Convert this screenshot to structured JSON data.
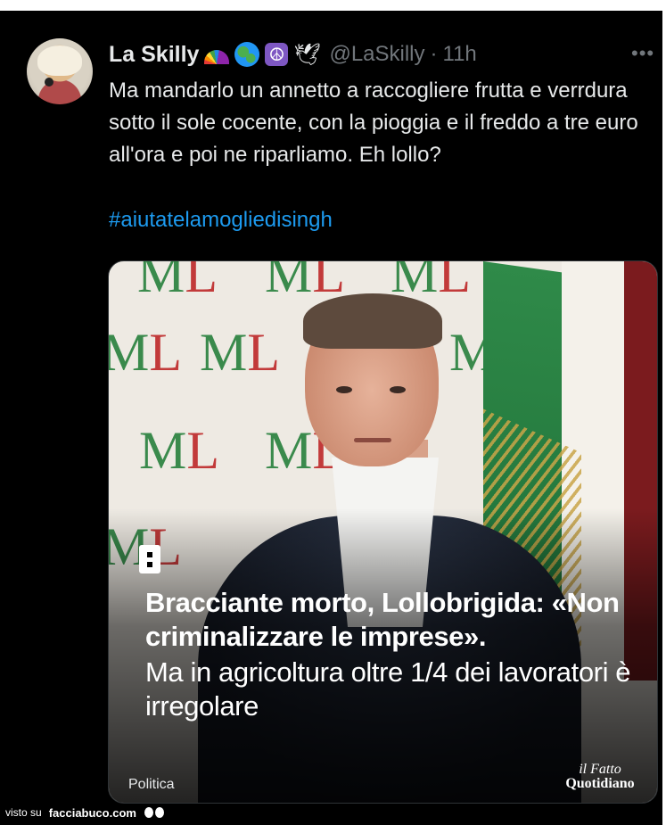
{
  "tweet": {
    "display_name": "La Skilly",
    "name_emojis": [
      "rainbow-emoji",
      "globe-emoji",
      "peace-symbol-emoji",
      "dove-emoji"
    ],
    "peace_glyph": "☮",
    "dove_glyph": "🕊",
    "handle": "@LaSkilly",
    "separator": "·",
    "time": "11h",
    "more_glyph": "•••",
    "text": "Ma mandarlo un annetto a raccogliere frutta e verrdura sotto il sole cocente, con la pioggia e il freddo a tre euro all'ora e poi ne riparliamo. Eh lollo?",
    "hashtag": "#aiutatelamogliedisingh"
  },
  "media": {
    "headline_bold": "Bracciante morto, Lollobrigida: «Non criminalizzare le imprese».",
    "headline_regular": "Ma in agricoltura oltre 1/4 dei lavoratori è irregolare",
    "category": "Politica",
    "source_line1": "il Fatto",
    "source_line2": "Quotidiano",
    "wall_logo_m": "M",
    "wall_logo_l": "L"
  },
  "watermark": {
    "prefix": "visto su",
    "site": "facciabuco.com"
  },
  "colors": {
    "background": "#000000",
    "text": "#e7e9ea",
    "muted": "#71767b",
    "link": "#1d9bf0"
  }
}
